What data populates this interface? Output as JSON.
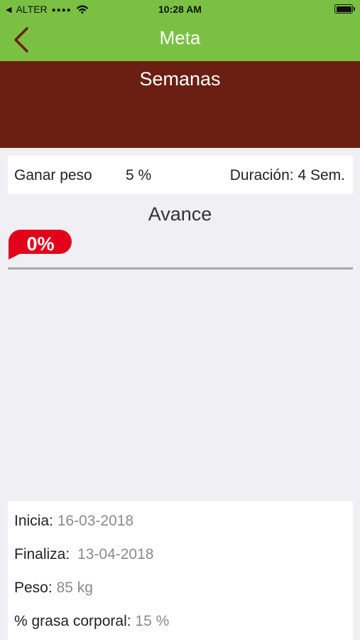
{
  "status_bar": {
    "carrier": "ALTER",
    "time": "10:28 AM"
  },
  "nav": {
    "title": "Meta"
  },
  "header": {
    "title": "Semanas"
  },
  "goal": {
    "type": "Ganar peso",
    "percent": "5 %",
    "duration_label": "Duración:",
    "duration_value": "4 Sem."
  },
  "progress": {
    "title": "Avance",
    "label": "0%",
    "fraction": 0
  },
  "details": {
    "start_label": "Inicia:",
    "start_value": "16-03-2018",
    "end_label": "Finaliza:",
    "end_value": "13-04-2018",
    "weight_label": "Peso:",
    "weight_value": "85 kg",
    "fat_label": "% grasa corporal:",
    "fat_value": "15 %"
  },
  "colors": {
    "nav_green": "#7ac143",
    "header_brown": "#6a1f12",
    "badge_red": "#e3001b"
  }
}
